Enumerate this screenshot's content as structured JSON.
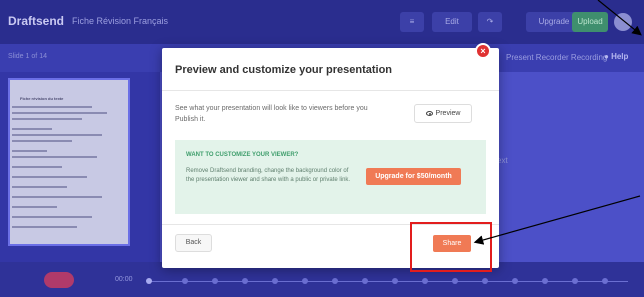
{
  "app": {
    "brand": "Draftsend",
    "document_title": "Fiche Révision Français",
    "toolbar": {
      "edit_label": "Edit",
      "upgrade_label": "Upgrade",
      "upload_label": "Upload"
    },
    "slide_counter": {
      "current": "1",
      "of": "of",
      "total": "14"
    },
    "right_subbar_text": "Present Recorder Recording",
    "help_label": "Help",
    "thumbnail_title": "Fiche révision du texte",
    "canvas_text": "ext",
    "timeline_time": "00:00"
  },
  "modal": {
    "title": "Preview and customize your presentation",
    "description": "See what your presentation will look like to viewers before you Publish it.",
    "preview_label": "Preview",
    "promo_title": "WANT TO CUSTOMIZE YOUR VIEWER?",
    "promo_text": "Remove Draftsend branding, change the background color of the presentation viewer and share with a public or private link.",
    "upgrade_label": "Upgrade for $50/month",
    "back_label": "Back",
    "share_label": "Share",
    "close_symbol": "×"
  },
  "colors": {
    "accent": "#f07a55",
    "promo_bg": "#e3f3ea",
    "promo_title": "#3f9e6c",
    "close_red": "#e03232",
    "highlight_red": "#e21d1d",
    "app_bg": "#3b3fb3"
  },
  "icons": {
    "preview": "eye-icon",
    "close": "close-icon",
    "help": "chat-bubble-icon",
    "edit": "pencil-icon",
    "share": "share-arrow-icon"
  }
}
